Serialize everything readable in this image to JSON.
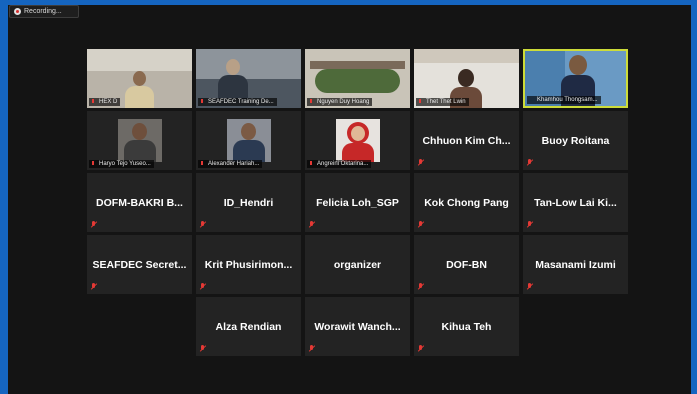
{
  "recording": {
    "label": "Recording..."
  },
  "colors": {
    "frame_bg": "#1565c0",
    "tile_bg": "#232323",
    "active_border": "#cddc39",
    "muted": "#e53935"
  },
  "video_tiles": [
    {
      "name": "HEX D"
    },
    {
      "name": "SEAFDEC Training De..."
    },
    {
      "name": "Nguyen Duy Hoang"
    },
    {
      "name": "Thet Thet Lwin"
    },
    {
      "name": "Khamhou Thongsam..."
    },
    {
      "name": "Haryo Tejo Yuseo..."
    },
    {
      "name": "Alexander Hariah..."
    },
    {
      "name": "Angreini Oktarina..."
    }
  ],
  "name_tiles": [
    {
      "name": "Chhuon Kim Ch..."
    },
    {
      "name": "Buoy Roitana"
    },
    {
      "name": "DOFM-BAKRI B..."
    },
    {
      "name": "ID_Hendri"
    },
    {
      "name": "Felicia Loh_SGP"
    },
    {
      "name": "Kok Chong Pang"
    },
    {
      "name": "Tan-Low Lai Ki..."
    },
    {
      "name": "SEAFDEC Secret..."
    },
    {
      "name": "Krit Phusirimon..."
    },
    {
      "name": "organizer"
    },
    {
      "name": "DOF-BN"
    },
    {
      "name": "Masanami Izumi"
    },
    {
      "name": "Alza Rendian"
    },
    {
      "name": "Worawit Wanch..."
    },
    {
      "name": "Kihua Teh"
    }
  ]
}
